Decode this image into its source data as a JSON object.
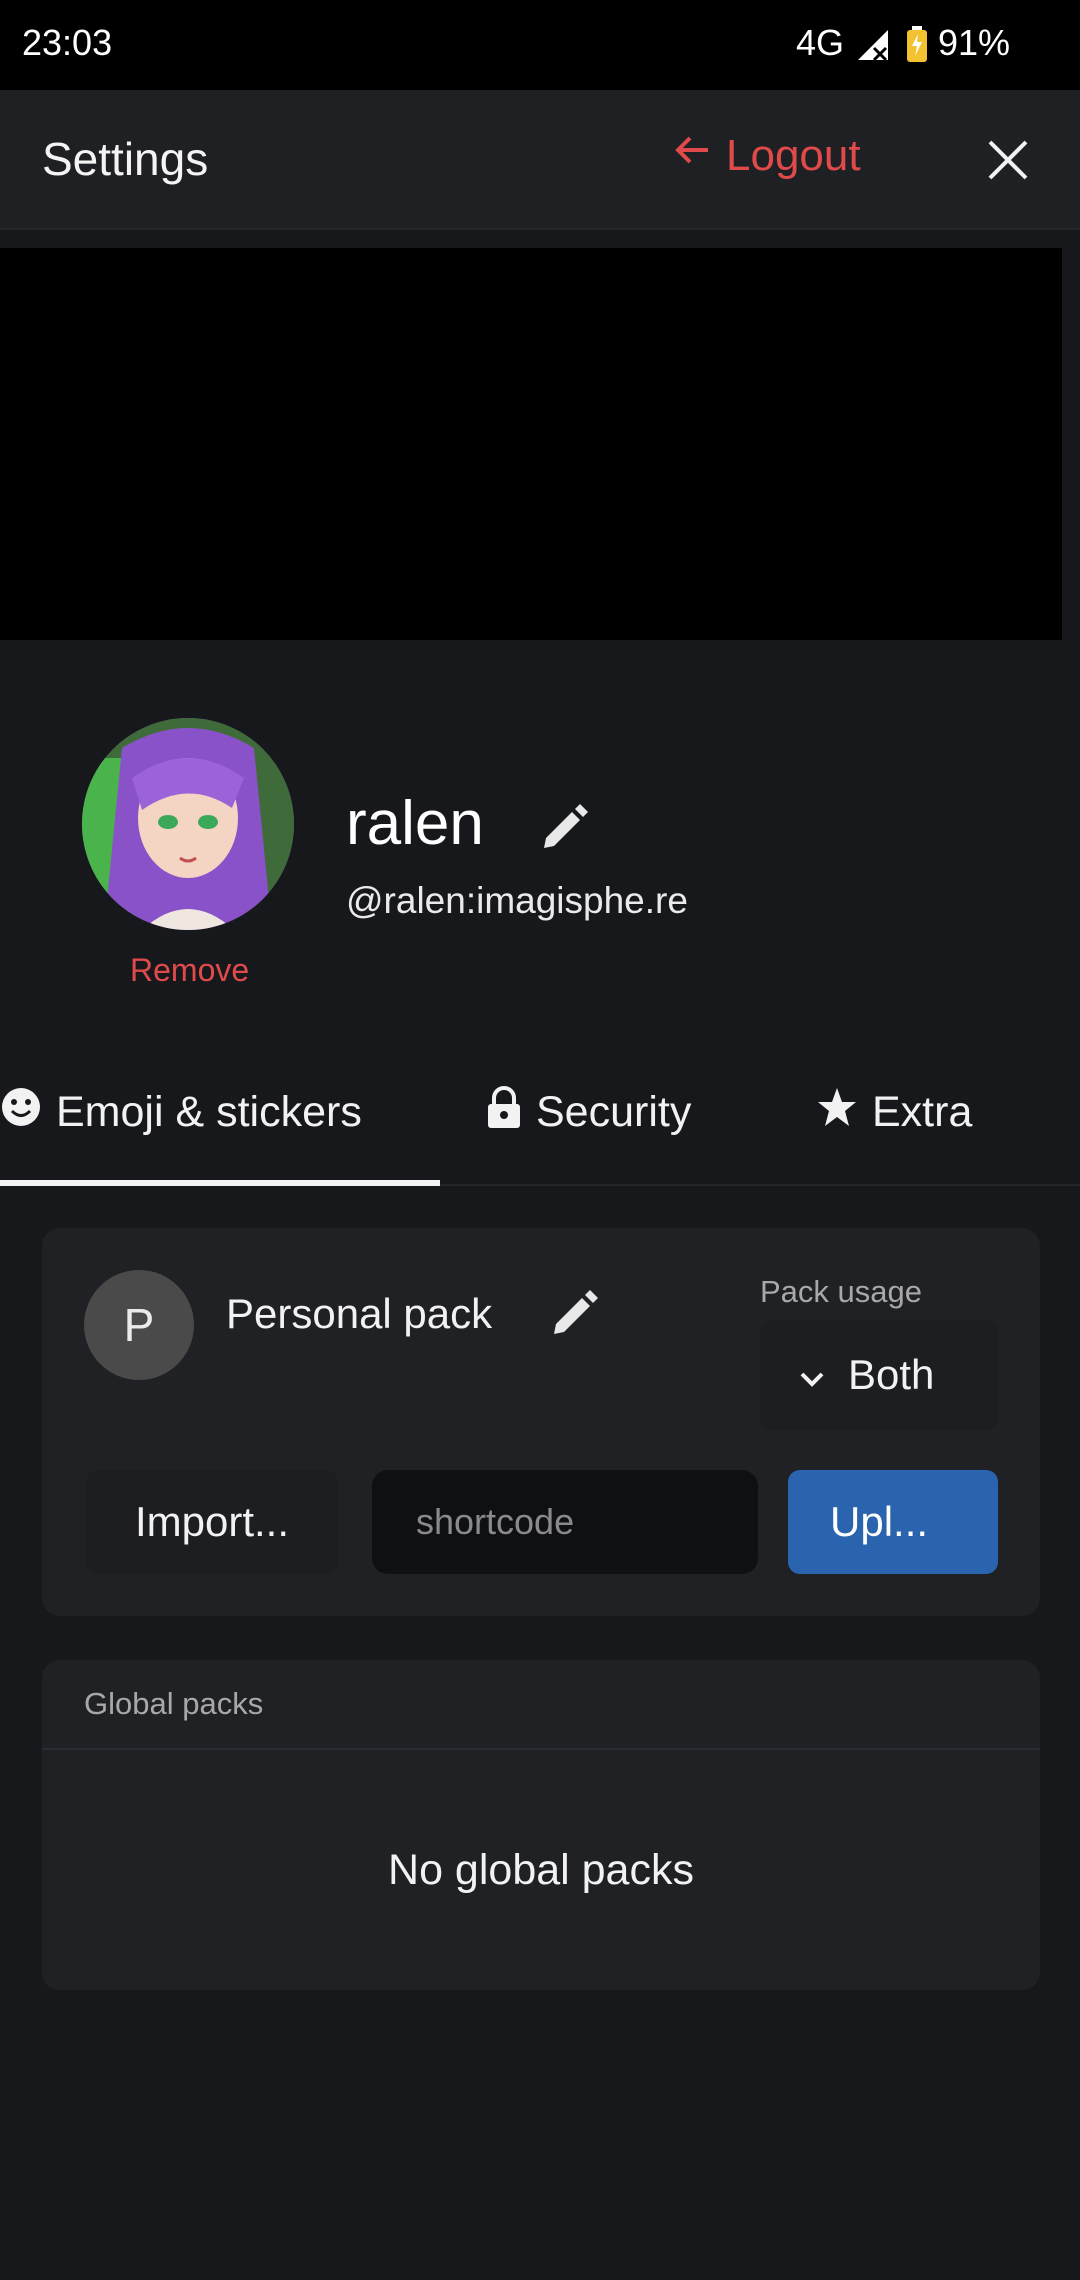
{
  "status_bar": {
    "time": "23:03",
    "network": "4G",
    "battery_pct": "91%"
  },
  "header": {
    "title": "Settings",
    "logout_label": "Logout",
    "close_icon": "close-icon",
    "logout_icon": "arrow-left-icon",
    "accent_color": "#e04a4a"
  },
  "profile": {
    "display_name": "ralen",
    "user_id": "@ralen:imagisphe.re",
    "remove_label": "Remove",
    "edit_icon": "pencil-icon"
  },
  "tabs": [
    {
      "label": "Emoji & stickers",
      "icon": "smiley-icon",
      "active": true
    },
    {
      "label": "Security",
      "icon": "lock-icon",
      "active": false
    },
    {
      "label": "Extra",
      "icon": "star-icon",
      "active": false
    }
  ],
  "personal_pack": {
    "avatar_letter": "P",
    "name": "Personal pack",
    "usage_label": "Pack usage",
    "usage_value": "Both",
    "import_label": "Import...",
    "shortcode_placeholder": "shortcode",
    "upload_label": "Upl...",
    "upload_color": "#2a64ae"
  },
  "global_packs": {
    "label": "Global packs",
    "empty_text": "No global packs"
  }
}
